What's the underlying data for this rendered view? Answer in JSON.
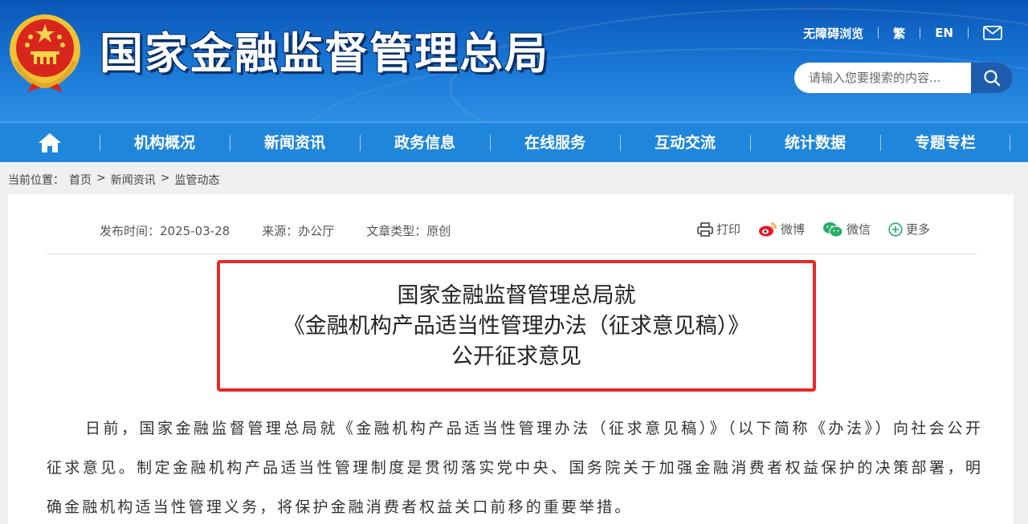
{
  "header": {
    "site_title": "国家金融监督管理总局",
    "top_links": {
      "accessibility": "无障碍浏览",
      "traditional": "繁",
      "english": "EN"
    },
    "search_placeholder": "请输入您要搜索的内容...",
    "colors": {
      "header_blue": "#1a78d6",
      "nav_blue": "#1f86dc",
      "search_button": "#1e5cad"
    }
  },
  "nav": {
    "items": [
      "机构概况",
      "新闻资讯",
      "政务信息",
      "在线服务",
      "互动交流",
      "统计数据",
      "专题专栏"
    ]
  },
  "breadcrumb": {
    "label": "当前位置：",
    "items": [
      "首页",
      "新闻资讯",
      "监管动态"
    ],
    "separator": ">"
  },
  "article": {
    "publish_time": "发布时间：2025-03-28",
    "source": "来源：办公厅",
    "type": "文章类型：原创",
    "share": {
      "print": "打印",
      "weibo": "微博",
      "wechat": "微信",
      "more": "更多"
    },
    "title_lines": [
      "国家金融监督管理总局就",
      "《金融机构产品适当性管理办法（征求意见稿）》",
      "公开征求意见"
    ],
    "highlight_color": "#e62a2a",
    "body": "日前，国家金融监督管理总局就《金融机构产品适当性管理办法（征求意见稿）》（以下简称《办法》）向社会公开征求意见。制定金融机构产品适当性管理制度是贯彻落实党中央、国务院关于加强金融消费者权益保护的决策部署，明确金融机构适当性管理义务，将保护金融消费者权益关口前移的重要举措。"
  },
  "icons": [
    "national-emblem-icon",
    "mail-icon",
    "search-icon",
    "home-icon",
    "print-icon",
    "weibo-icon",
    "wechat-icon",
    "more-plus-icon"
  ]
}
